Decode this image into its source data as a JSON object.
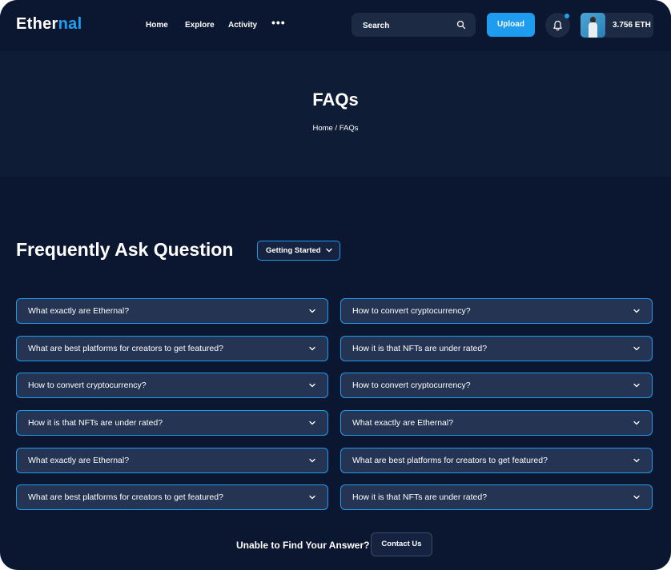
{
  "header": {
    "logo_main": "Ether",
    "logo_accent": "nal",
    "nav": {
      "home": "Home",
      "explore": "Explore",
      "activity": "Activity",
      "more": "•••"
    },
    "search_placeholder": "Search",
    "upload_label": "Upload",
    "wallet_balance": "3.756 ETH"
  },
  "hero": {
    "title": "FAQs",
    "breadcrumb": "Home / FAQs"
  },
  "faq": {
    "title": "Frequently Ask Question",
    "category": "Getting Started",
    "left": [
      "What exactly are Ethernal?",
      "What are best platforms for creators to get featured?",
      "How to convert cryptocurrency?",
      "How it is that NFTs are under rated?",
      "What exactly are Ethernal?",
      "What are best platforms for creators to get featured?"
    ],
    "right": [
      "How to convert cryptocurrency?",
      "How it is that NFTs are under rated?",
      "How to convert cryptocurrency?",
      "What exactly are Ethernal?",
      "What are best platforms for creators to get featured?",
      "How it is that NFTs are under rated?"
    ]
  },
  "footer_cta": {
    "text": "Unable to Find Your Answer?",
    "button": "Contact Us"
  },
  "colors": {
    "background": "#0b1730",
    "accent": "#1e9cf0",
    "card": "#253453"
  }
}
